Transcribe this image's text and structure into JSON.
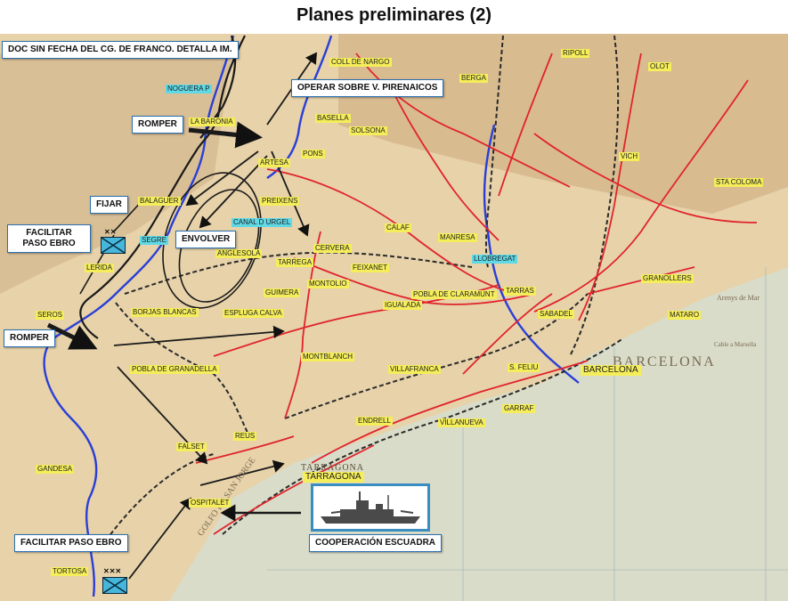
{
  "title": "Planes preliminares (2)",
  "callouts": {
    "doc": "DOC SIN FECHA DEL CG. DE FRANCO. DETALLA IM.",
    "operar": "OPERAR SOBRE V. PIRENAICOS",
    "romper_top": "ROMPER",
    "fijar": "FIJAR",
    "facilitar_top": "FACILITAR PASO EBRO",
    "envolver": "ENVOLVER",
    "romper_mid": "ROMPER",
    "facilitar_bottom": "FACILITAR PASO EBRO",
    "cooperacion": "COOPERACIÓN ESCUADRA"
  },
  "places": {
    "coll_de_nargo": "COLL DE NARGO",
    "ripoll": "RIPOLL",
    "olot": "OLOT",
    "noguera_p": "NOGUERA P",
    "berga": "BERGA",
    "la_baronia": "LA BARONIA",
    "basella": "BASELLA",
    "solsona": "SOLSONA",
    "artesa": "ARTESA",
    "pons": "PONS",
    "vich": "VICH",
    "balaguer": "BALAGUER",
    "preixens": "PREIXENS",
    "sta_coloma": "STA COLOMA",
    "canal_d_urgel": "CANAL D URGEL",
    "segre": "SEGRE",
    "calaf": "CALAF",
    "manresa": "MANRESA",
    "cervera": "CERVERA",
    "lerida": "LERIDA",
    "anglesola": "ANGLESOLA",
    "tarrega": "TARREGA",
    "llobregat": "LLOBREGAT",
    "feixanet": "FEIXANET",
    "granollers": "GRANOLLERS",
    "montolio": "MONTOLIO",
    "guimera": "GUIMERA",
    "pobla_de_claramunt": "POBLA DE CLARAMUNT",
    "tarrasa": "TARRAS",
    "igualada": "IGUALADA",
    "seros": "SEROS",
    "borjas_blancas": "BORJAS BLANCAS",
    "espluga_calva": "ESPLUGA CALVA",
    "sabadel": "SABADEL",
    "mataro": "MATARO",
    "pobla_de_granadella": "POBLA DE GRANADELLA",
    "montblanch": "MONTBLANCH",
    "villafranca": "VILLAFRANCA",
    "s_feliu": "S. FELIU",
    "barcelona": "BARCELONA",
    "garraf": "GARRAF",
    "endrell": "ENDRELL",
    "villanueva": "VILLANUEVA",
    "reus": "REUS",
    "falset": "FALSET",
    "gandesa": "GANDESA",
    "tarragona": "TARRAGONA",
    "ospitalet": "OSPITALET",
    "tortosa": "TORTOSA"
  },
  "map_text": {
    "barcelona_sea": "BARCELONA",
    "tarragona_map": "TARRAGONA",
    "golfo": "GOLFO DE SAN JORGE",
    "cable": "Cable a Marsella",
    "arenys": "Arenys de Mar"
  },
  "colors": {
    "roads": "#e0242c",
    "railways": "#2a2a2a",
    "rivers": "#2a3fd6",
    "frontline": "#1a1a1a",
    "sea": "#d9dcc8",
    "land": "#e7d2a9",
    "place_label_bg": "#f5ee5a",
    "water_label_bg": "#5fd9e6",
    "unit_symbol": "#45b6dc",
    "callout_border": "#2a6fb0"
  },
  "icons": [
    "infantry-unit-icon",
    "battleship-icon",
    "attack-arrow-icon"
  ]
}
